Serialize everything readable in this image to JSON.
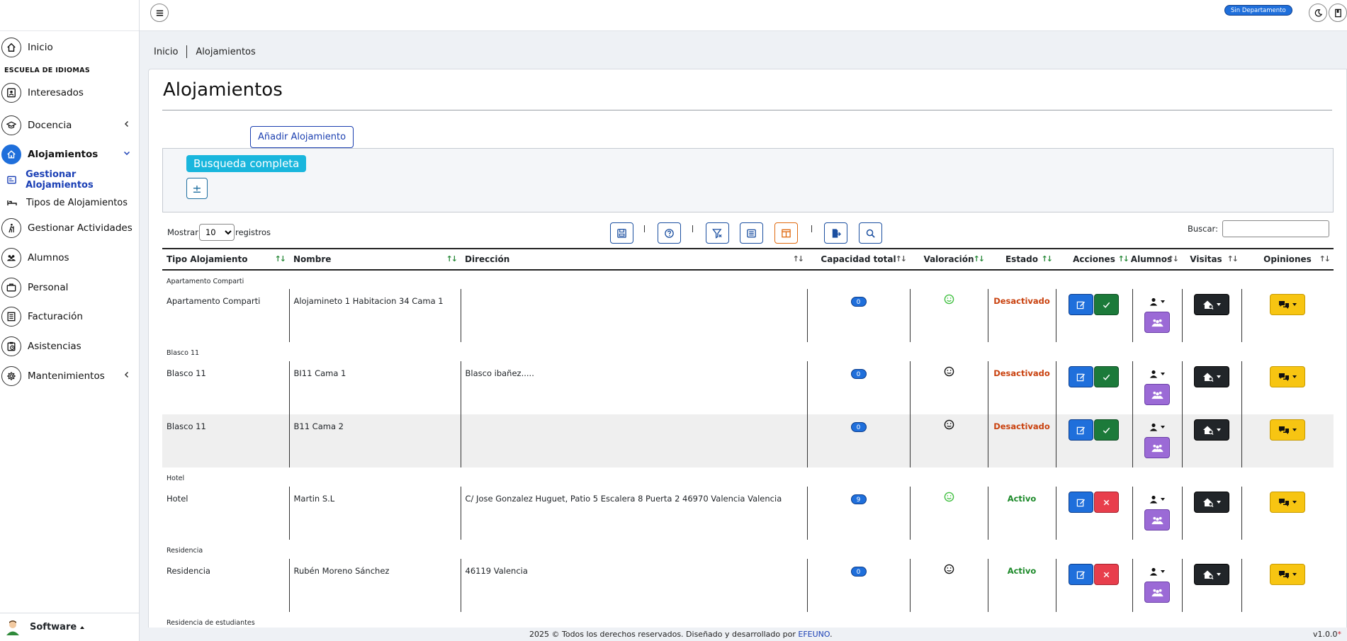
{
  "sidebar": {
    "home_label": "Inicio",
    "section_title": "ESCUELA DE IDIOMAS",
    "items": [
      {
        "label": "Interesados"
      },
      {
        "label": "Docencia"
      },
      {
        "label": "Alojamientos"
      },
      {
        "label": "Gestionar Alojamientos"
      },
      {
        "label": "Tipos de Alojamientos"
      },
      {
        "label": "Gestionar Actividades"
      },
      {
        "label": "Alumnos"
      },
      {
        "label": "Personal"
      },
      {
        "label": "Facturación"
      },
      {
        "label": "Asistencias"
      },
      {
        "label": "Mantenimientos"
      }
    ],
    "footer_label": "Software"
  },
  "topbar": {
    "dept_badge": "Sin Departamento"
  },
  "breadcrumb": {
    "home": "Inicio",
    "current": "Alojamientos"
  },
  "page": {
    "title": "Alojamientos",
    "add_button": "Añadir Alojamiento",
    "search_toggle": "Busqueda completa",
    "plusminus": "±"
  },
  "table_controls": {
    "show_label": "Mostrar",
    "page_size": "10",
    "records_label": "registros",
    "search_label": "Buscar:"
  },
  "table": {
    "headers": [
      "Tipo Alojamiento",
      "Nombre",
      "Dirección",
      "Capacidad total",
      "Valoración",
      "Estado",
      "Acciones",
      "Alumnos",
      "Visitas",
      "Opiniones"
    ],
    "groups": [
      "Apartamento Comparti",
      "Blasco 11",
      "Hotel",
      "Residencia",
      "Residencia de estudiantes"
    ],
    "rows": [
      {
        "tipo": "Apartamento Comparti",
        "nombre": "Alojamineto 1 Habitacion 34 Cama 1",
        "direccion": "",
        "capacidad": "0",
        "valoracion": "happy",
        "estado": "Desactivado"
      },
      {
        "tipo": "Blasco 11",
        "nombre": "BI11 Cama 1",
        "direccion": "Blasco ibañez.....",
        "capacidad": "0",
        "valoracion": "neutral",
        "estado": "Desactivado"
      },
      {
        "tipo": "Blasco 11",
        "nombre": "B11 Cama 2",
        "direccion": "",
        "capacidad": "0",
        "valoracion": "neutral",
        "estado": "Desactivado"
      },
      {
        "tipo": "Hotel",
        "nombre": "Martin S.L",
        "direccion": "C/ Jose Gonzalez Huguet, Patio 5 Escalera 8 Puerta 2 46970 Valencia Valencia",
        "capacidad": "9",
        "valoracion": "happy",
        "estado": "Activo"
      },
      {
        "tipo": "Residencia",
        "nombre": "Rubén Moreno Sánchez",
        "direccion": "46119 Valencia",
        "capacidad": "0",
        "valoracion": "neutral",
        "estado": "Activo"
      }
    ]
  },
  "footer": {
    "copyright": "2025 © Todos los derechos reservados. Diseñado y desarrollado por ",
    "company": "EFEUNO",
    "dot": ".",
    "version": "v1.0.0",
    "version_mark": "*"
  },
  "colors": {
    "primary": "#1f6fdb",
    "success": "#1c7a3a",
    "danger": "#e83e4c",
    "warning": "#f7c512",
    "info": "#19b6dd",
    "purple": "#9b6ad6",
    "dark": "#212529",
    "status_off": "#c9420f",
    "status_on": "#1d8a2a"
  }
}
